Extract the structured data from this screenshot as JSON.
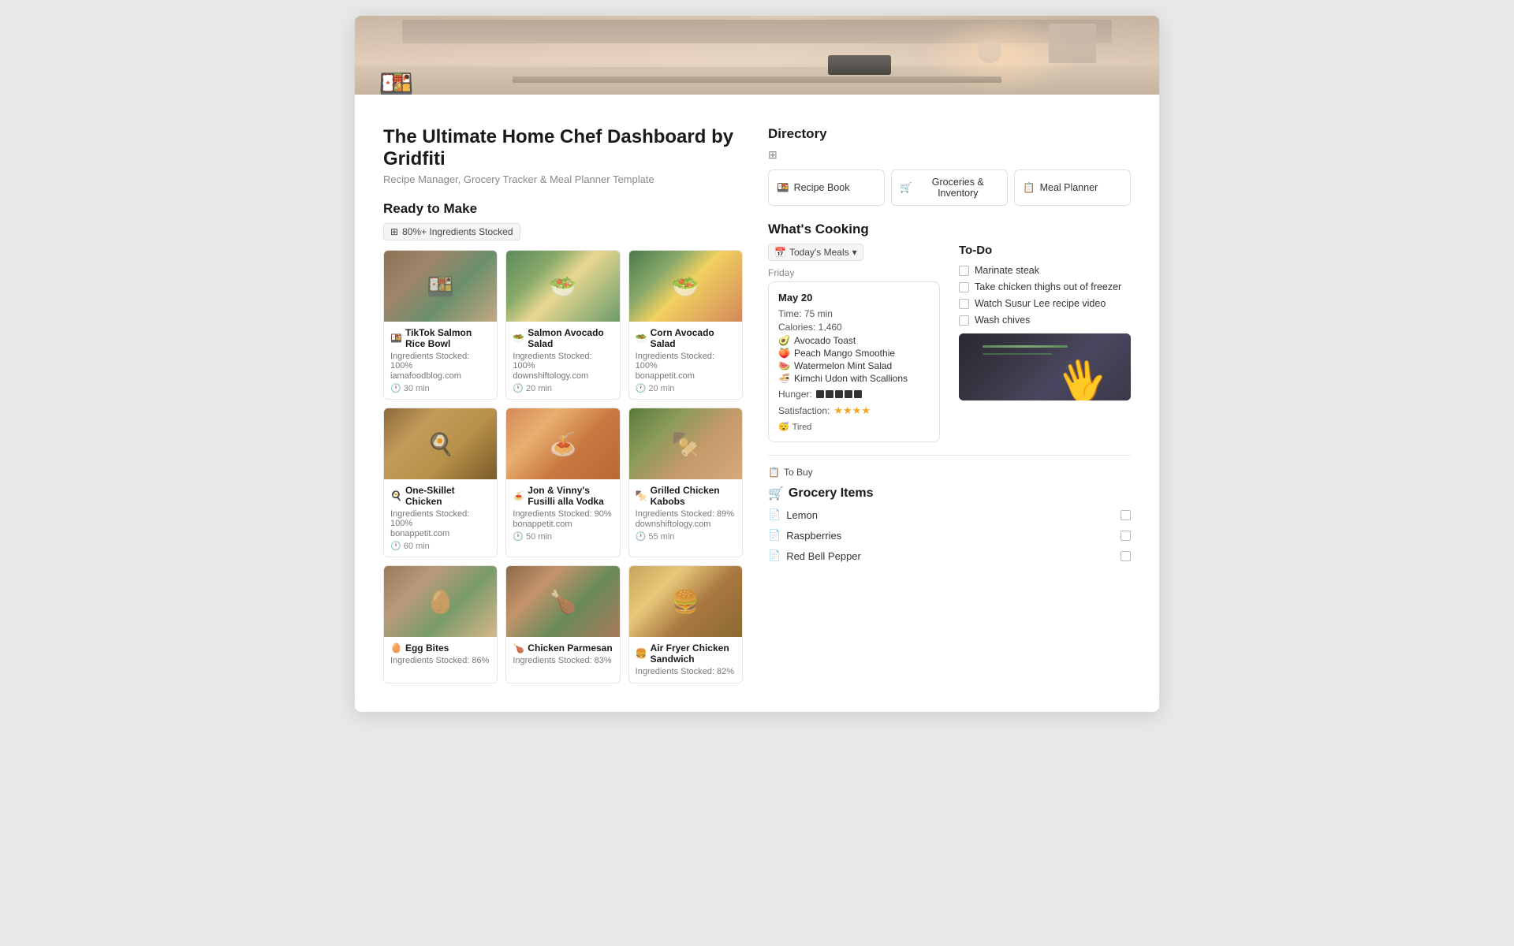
{
  "page": {
    "title": "The Ultimate Home Chef Dashboard by Gridfiti",
    "subtitle": "Recipe Manager, Grocery Tracker & Meal Planner Template",
    "emoji": "🍱"
  },
  "ready_section": {
    "heading": "Ready to Make",
    "filter_label": "80%+ Ingredients Stocked",
    "filter_icon": "⊞"
  },
  "recipes": [
    {
      "name": "TikTok Salmon Rice Bowl",
      "emoji": "🍱",
      "stocked": "Ingredients Stocked: 100%",
      "source": "iamafoodblog.com",
      "time": "30 min",
      "color_class": "food-salmon-bowl"
    },
    {
      "name": "Salmon Avocado Salad",
      "emoji": "🥗",
      "stocked": "Ingredients Stocked: 100%",
      "source": "downshiftology.com",
      "time": "20 min",
      "color_class": "food-avocado-salad"
    },
    {
      "name": "Corn Avocado Salad",
      "emoji": "🥗",
      "stocked": "Ingredients Stocked: 100%",
      "source": "bonappetit.com",
      "time": "20 min",
      "color_class": "food-corn-salad"
    },
    {
      "name": "One-Skillet Chicken",
      "emoji": "🍳",
      "stocked": "Ingredients Stocked: 100%",
      "source": "bonappetit.com",
      "time": "60 min",
      "color_class": "food-chicken"
    },
    {
      "name": "Jon & Vinny's Fusilli alla Vodka",
      "emoji": "🍝",
      "stocked": "Ingredients Stocked: 90%",
      "source": "bonappetit.com",
      "time": "50 min",
      "color_class": "food-pasta"
    },
    {
      "name": "Grilled Chicken Kabobs",
      "emoji": "🍢",
      "stocked": "Ingredients Stocked: 89%",
      "source": "downshiftology.com",
      "time": "55 min",
      "color_class": "food-kabobs"
    },
    {
      "name": "Egg Bites",
      "emoji": "🥚",
      "stocked": "Ingredients Stocked: 86%",
      "source": "",
      "time": "",
      "color_class": "food-egg"
    },
    {
      "name": "Chicken Parmesan",
      "emoji": "🍗",
      "stocked": "Ingredients Stocked: 83%",
      "source": "",
      "time": "",
      "color_class": "food-chxparm"
    },
    {
      "name": "Air Fryer Chicken Sandwich",
      "emoji": "🍔",
      "stocked": "Ingredients Stocked: 82%",
      "source": "",
      "time": "",
      "color_class": "food-sandwich"
    }
  ],
  "directory": {
    "title": "Directory",
    "grid_icon": "⊞",
    "buttons": [
      {
        "label": "Recipe Book",
        "emoji": "🍱"
      },
      {
        "label": "Groceries & Inventory",
        "emoji": "🛒"
      },
      {
        "label": "Meal Planner",
        "emoji": "📋"
      }
    ]
  },
  "whats_cooking": {
    "title": "What's Cooking",
    "filter_label": "Today's Meals",
    "day": "Friday",
    "meal_card": {
      "date": "May 20",
      "time": "Time: 75 min",
      "calories": "Calories: 1,460",
      "items": [
        {
          "emoji": "🥑",
          "name": "Avocado Toast"
        },
        {
          "emoji": "🍑",
          "name": "Peach Mango Smoothie"
        },
        {
          "emoji": "🍉",
          "name": "Watermelon Mint Salad"
        },
        {
          "emoji": "🍜",
          "name": "Kimchi Udon with Scallions"
        }
      ],
      "hunger_label": "Hunger:",
      "hunger_blocks": 5,
      "satisfaction_label": "Satisfaction:",
      "satisfaction_stars": "★★★★",
      "energy_label": "Tired",
      "energy_emoji": "😴"
    }
  },
  "todo": {
    "title": "To-Do",
    "items": [
      "Marinate steak",
      "Take chicken thighs out of freezer",
      "Watch Susur Lee recipe video",
      "Wash chives"
    ]
  },
  "grocery": {
    "to_buy_label": "To Buy",
    "to_buy_icon": "📋",
    "title": "Grocery Items",
    "title_emoji": "🛒",
    "items": [
      "Lemon",
      "Raspberries",
      "Red Bell Pepper"
    ]
  }
}
